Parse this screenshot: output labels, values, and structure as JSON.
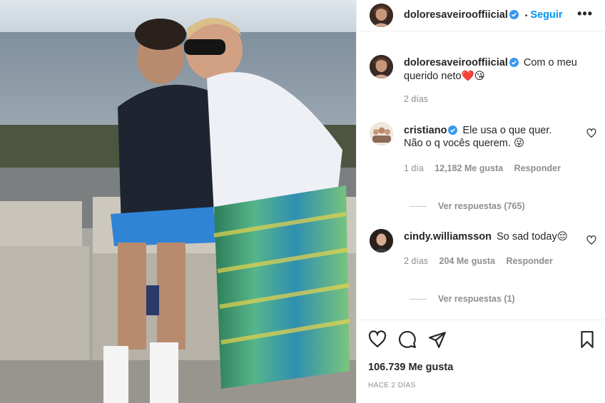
{
  "post": {
    "photo_alt_icon": "post-photo",
    "header": {
      "username": "doloresaveirooffiicial",
      "verified": true,
      "separator": "•",
      "follow_label": "Seguir",
      "more_icon": "more-horizontal-icon"
    },
    "caption": {
      "username": "doloresaveirooffiicial",
      "text_line1": "Com o meu",
      "text_line2": "querido neto❤️😘",
      "time": "2 días"
    },
    "comments": [
      {
        "username": "cristiano",
        "verified": true,
        "text_line1": "Ele usa o que quer.",
        "text_line2": "Não o q vocês querem. 😜",
        "time": "1 día",
        "likes": "12,182 Me gusta",
        "reply_label": "Responder",
        "view_replies": "Ver respuestas (765)"
      },
      {
        "username": "cindy.williamsson",
        "verified": false,
        "text_line1": "So sad today😔",
        "time": "2 días",
        "likes": "204 Me gusta",
        "reply_label": "Responder",
        "view_replies": "Ver respuestas (1)"
      }
    ],
    "actions": {
      "like_icon": "heart-icon",
      "comment_icon": "comment-icon",
      "share_icon": "send-icon",
      "save_icon": "bookmark-icon"
    },
    "likes_count": "106.739 Me gusta",
    "posted_ago": "HACE 2 DÍAS"
  },
  "colors": {
    "accent": "#0095f6",
    "verified": "#3897f0",
    "text": "#262626",
    "muted": "#8e8e8e"
  }
}
